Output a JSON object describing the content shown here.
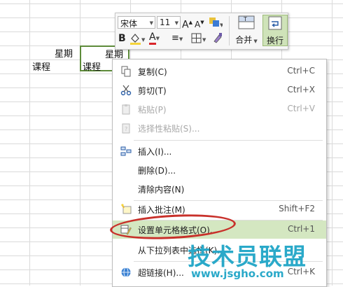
{
  "sheet": {
    "cells": {
      "a_top": "星期",
      "a_bottom": "课程",
      "b_top": "星期",
      "b_bottom": "课程"
    }
  },
  "mini_toolbar": {
    "font_name": "宋体",
    "font_size": "11",
    "grow_font_icon": "A",
    "shrink_font_icon": "A",
    "bold_label": "B",
    "font_color_label": "A",
    "merge_label": "合并",
    "wrap_label": "换行",
    "colors": {
      "highlight": "#f5d43a",
      "font_color": "#d9262b"
    }
  },
  "context_menu": {
    "items": [
      {
        "label": "复制(C)",
        "shortcut": "Ctrl+C",
        "icon": "copy-icon",
        "enabled": true
      },
      {
        "label": "剪切(T)",
        "shortcut": "Ctrl+X",
        "icon": "scissors-icon",
        "enabled": true
      },
      {
        "label": "粘贴(P)",
        "shortcut": "Ctrl+V",
        "icon": "paste-icon",
        "enabled": false
      },
      {
        "label": "选择性粘贴(S)...",
        "shortcut": "",
        "icon": "paste-special-icon",
        "enabled": false
      },
      {
        "label": "插入(I)...",
        "shortcut": "",
        "icon": "insert-icon",
        "enabled": true
      },
      {
        "label": "删除(D)...",
        "shortcut": "",
        "icon": "",
        "enabled": true
      },
      {
        "label": "清除内容(N)",
        "shortcut": "",
        "icon": "",
        "enabled": true
      },
      {
        "label": "插入批注(M)",
        "shortcut": "Shift+F2",
        "icon": "comment-icon",
        "enabled": true
      },
      {
        "label": "设置单元格格式(O)...",
        "shortcut": "Ctrl+1",
        "icon": "format-cells-icon",
        "enabled": true,
        "highlighted": true
      },
      {
        "label": "从下拉列表中选择(K)...",
        "shortcut": "",
        "icon": "",
        "enabled": true
      },
      {
        "label": "超链接(H)...",
        "shortcut": "Ctrl+K",
        "icon": "hyperlink-icon",
        "enabled": true
      }
    ]
  },
  "watermark": {
    "brand": "技术员联盟",
    "url": "www.jsgho.com"
  },
  "colors": {
    "accent_green": "#5d8b3a",
    "highlight_bg": "#d4e7c1",
    "annotation_red": "#c8302a",
    "watermark_blue": "#2aa9c9"
  }
}
